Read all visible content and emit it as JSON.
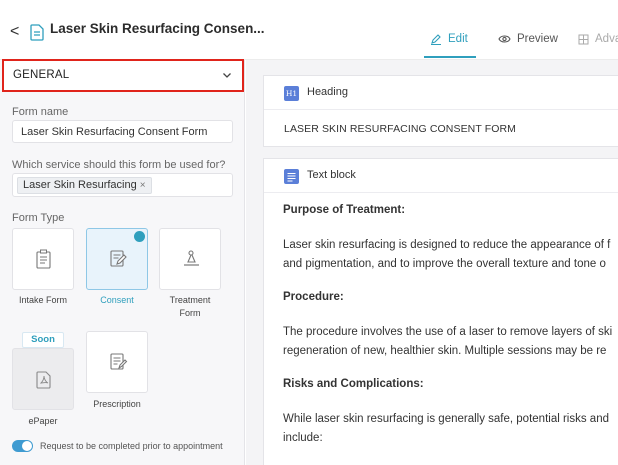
{
  "header": {
    "back_label": "<",
    "title": "Laser Skin Resurfacing Consen...",
    "tabs": [
      {
        "label": "Edit",
        "active": true
      },
      {
        "label": "Preview",
        "active": false
      },
      {
        "label": "Adva",
        "active": false
      }
    ]
  },
  "sidebar": {
    "section_title": "GENERAL",
    "form_name_label": "Form name",
    "form_name_value": "Laser Skin Resurfacing Consent Form",
    "service_label": "Which service should this form be used for?",
    "service_chip": "Laser Skin Resurfacing",
    "service_chip_remove": "×",
    "form_type_label": "Form Type",
    "form_types": [
      {
        "label": "Intake Form",
        "icon": "clipboard-icon",
        "selected": false
      },
      {
        "label": "Consent",
        "icon": "pen-document-icon",
        "selected": true
      },
      {
        "label": "Treatment",
        "label2": "Form",
        "icon": "treatment-icon",
        "selected": false
      },
      {
        "label": "ePaper",
        "icon": "pdf-icon",
        "selected": false,
        "badge": "Soon"
      },
      {
        "label": "Prescription",
        "icon": "prescription-icon",
        "selected": false
      }
    ],
    "toggle_label": "Request to be completed prior to appointment",
    "toggle_on": true
  },
  "blocks": {
    "heading": {
      "icon_label": "H1",
      "name": "Heading",
      "text": "LASER SKIN RESURFACING CONSENT FORM"
    },
    "text_block": {
      "icon": "align-icon",
      "name": "Text block",
      "lines": [
        "Purpose of Treatment:",
        "Laser skin resurfacing is designed to reduce the appearance of f",
        "and pigmentation, and to improve the overall texture and tone o",
        "Procedure:",
        "The procedure involves the use of a laser to remove layers of ski",
        "regeneration of new, healthier skin. Multiple sessions may be re",
        "Risks and Complications:",
        "While laser skin resurfacing is generally safe, potential risks and",
        "include:"
      ]
    }
  },
  "colors": {
    "accent": "#2f9fbd",
    "highlight_border": "#e0241b",
    "block_icon": "#5b7fd8"
  }
}
